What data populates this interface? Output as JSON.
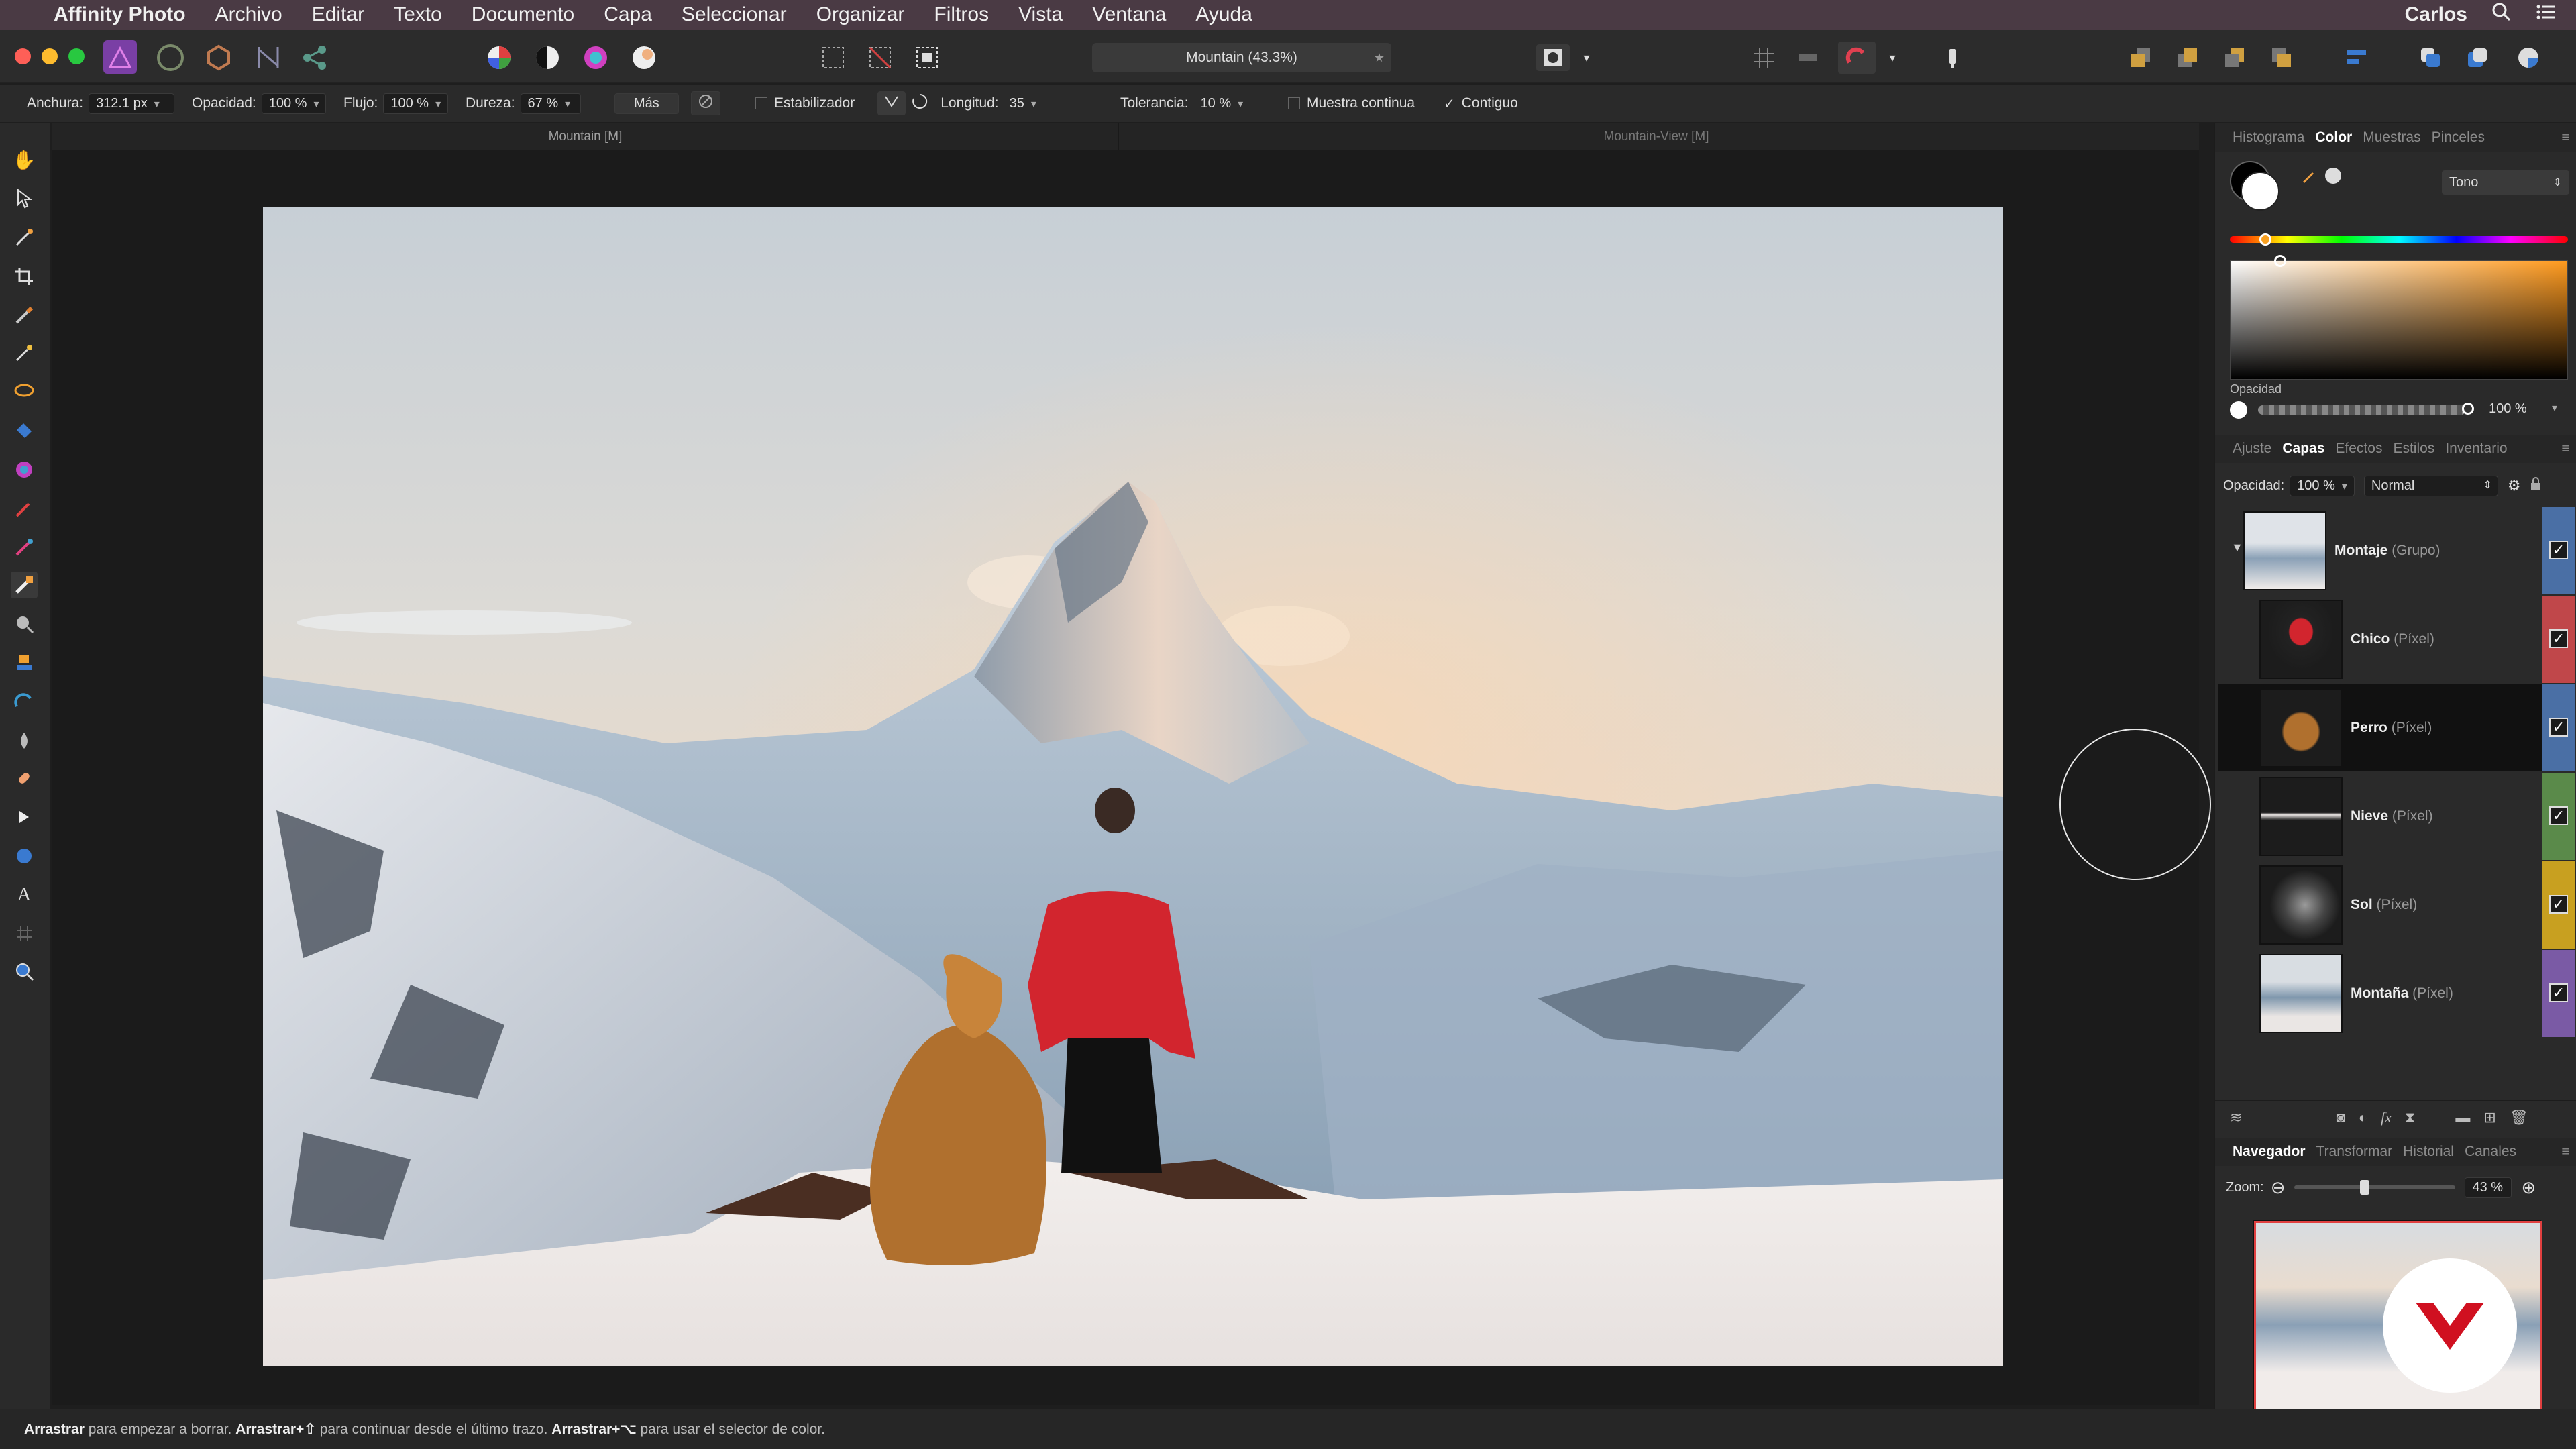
{
  "menubar": {
    "app_name": "Affinity Photo",
    "items": [
      "Archivo",
      "Editar",
      "Texto",
      "Documento",
      "Capa",
      "Seleccionar",
      "Organizar",
      "Filtros",
      "Vista",
      "Ventana",
      "Ayuda"
    ],
    "user": "Carlos"
  },
  "toolbar": {
    "document_title": "Mountain (43.3%)"
  },
  "context": {
    "width_label": "Anchura:",
    "width_value": "312.1 px",
    "opacity_label": "Opacidad:",
    "opacity_value": "100 %",
    "flow_label": "Flujo:",
    "flow_value": "100 %",
    "hardness_label": "Dureza:",
    "hardness_value": "67 %",
    "more_label": "Más",
    "stabilizer_label": "Estabilizador",
    "length_label": "Longitud:",
    "length_value": "35",
    "tolerance_label": "Tolerancia:",
    "tolerance_value": "10 %",
    "continuous_label": "Muestra continua",
    "contiguous_label": "Contiguo",
    "contiguous_checked": true
  },
  "doc_tabs": [
    "Mountain [M]",
    "Mountain-View [M]"
  ],
  "tools": [
    "hand-icon",
    "move-icon",
    "eyedropper-icon",
    "crop-icon",
    "selection-brush-icon",
    "magic-wand-icon",
    "lasso-icon",
    "fill-icon",
    "color-picker-icon",
    "paint-brush-icon",
    "color-replacement-icon",
    "erase-brush-icon",
    "dodge-icon",
    "clone-icon",
    "retouch-icon",
    "blur-icon",
    "healing-icon",
    "node-icon",
    "shape-icon",
    "text-icon",
    "mesh-icon",
    "zoom-icon"
  ],
  "color_panel": {
    "tabs": [
      "Histograma",
      "Color",
      "Muestras",
      "Pinceles"
    ],
    "active_tab": "Color",
    "mode": "Tono",
    "opacity_label": "Opacidad",
    "opacity_value": "100 %",
    "hue_color": "#ff9a1e"
  },
  "layers_panel": {
    "tabs": [
      "Ajuste",
      "Capas",
      "Efectos",
      "Estilos",
      "Inventario"
    ],
    "active_tab": "Capas",
    "opacity_label": "Opacidad:",
    "opacity_value": "100 %",
    "blend_mode": "Normal",
    "layers": [
      {
        "name": "Montaje",
        "type": "(Grupo)",
        "color": "#4a6fa5",
        "selected": false
      },
      {
        "name": "Chico",
        "type": "(Píxel)",
        "color": "#c0474a",
        "selected": false
      },
      {
        "name": "Perro",
        "type": "(Píxel)",
        "color": "#4a6fa5",
        "selected": true
      },
      {
        "name": "Nieve",
        "type": "(Píxel)",
        "color": "#5a8a4a",
        "selected": false
      },
      {
        "name": "Sol",
        "type": "(Píxel)",
        "color": "#c8a020",
        "selected": false
      },
      {
        "name": "Montaña",
        "type": "(Píxel)",
        "color": "#7a5aa5",
        "selected": false
      }
    ]
  },
  "navigator_panel": {
    "tabs": [
      "Navegador",
      "Transformar",
      "Historial",
      "Canales"
    ],
    "active_tab": "Navegador",
    "zoom_label": "Zoom:",
    "zoom_value": "43 %",
    "zoom_fraction": 0.43
  },
  "status": {
    "part1_bold": "Arrastrar",
    "part1": " para empezar a borrar. ",
    "part2_bold": "Arrastrar+⇧",
    "part2": " para continuar desde el último trazo. ",
    "part3_bold": "Arrastrar+⌥",
    "part3": " para usar el selector de color."
  }
}
